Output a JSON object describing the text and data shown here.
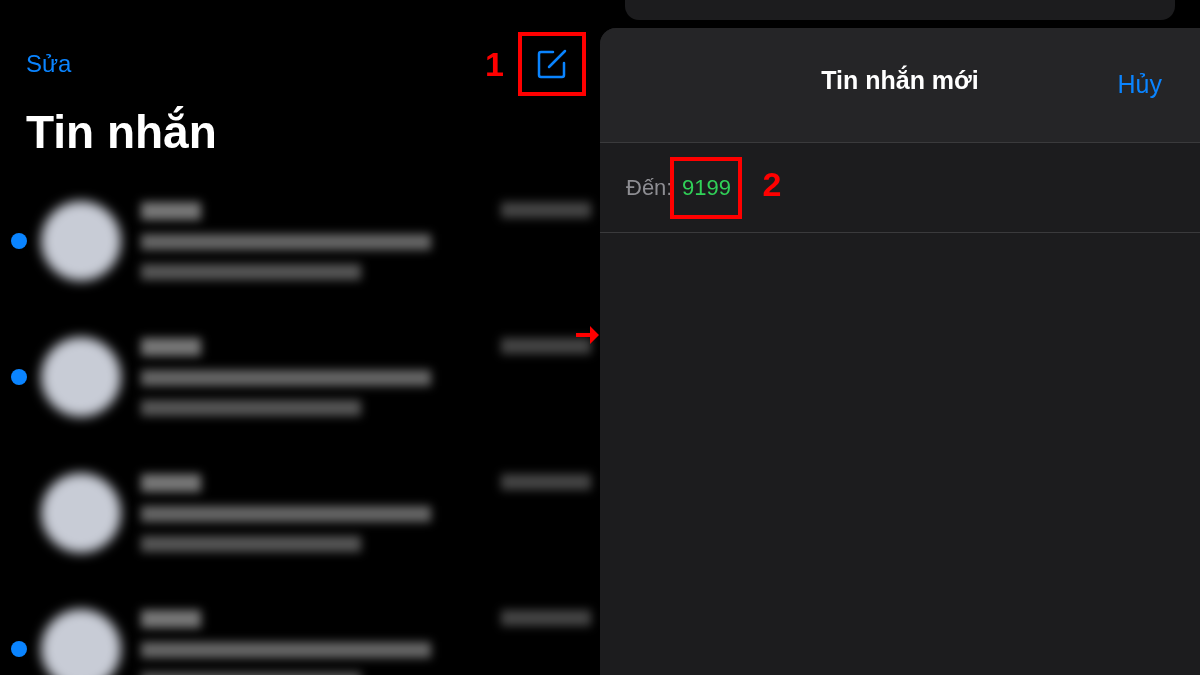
{
  "messages_screen": {
    "edit_link": "Sửa",
    "title": "Tin nhắn",
    "conversations": [
      {
        "unread": true
      },
      {
        "unread": true
      },
      {
        "unread": false
      },
      {
        "unread": true
      }
    ]
  },
  "new_message_sheet": {
    "title": "Tin nhắn mới",
    "cancel": "Hủy",
    "to_label": "Đến:",
    "to_value": "9199"
  },
  "annotations": [
    {
      "kind": "step",
      "label": "1"
    },
    {
      "kind": "step",
      "label": "2"
    }
  ]
}
